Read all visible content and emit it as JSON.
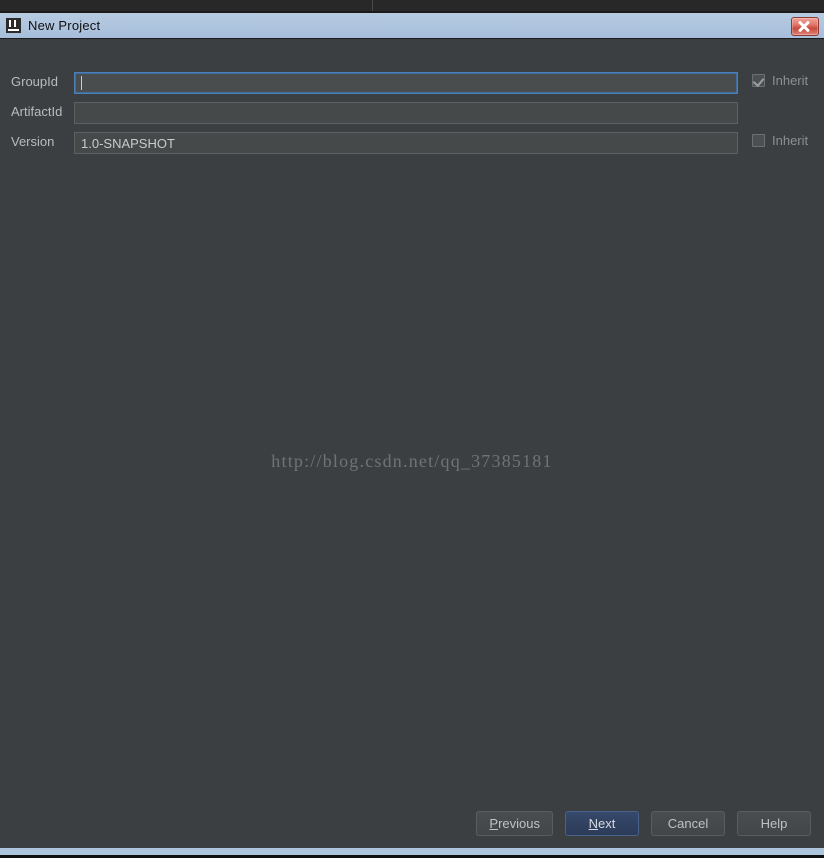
{
  "window": {
    "title": "New Project",
    "app_icon": "intellij-idea-logo-icon",
    "close_icon": "close-icon",
    "titlebar_color": "#b0c6de",
    "body_color": "#3c3f41",
    "frame_accent_color": "#aec5de"
  },
  "form": {
    "rows": [
      {
        "label": "GroupId",
        "value": "",
        "placeholder": "",
        "focused": true,
        "has_inherit": true,
        "inherit_label": "Inherit",
        "inherit_checked": true
      },
      {
        "label": "ArtifactId",
        "value": "",
        "placeholder": "",
        "focused": false,
        "has_inherit": false,
        "inherit_label": "",
        "inherit_checked": false
      },
      {
        "label": "Version",
        "value": "1.0-SNAPSHOT",
        "placeholder": "",
        "focused": false,
        "has_inherit": true,
        "inherit_label": "Inherit",
        "inherit_checked": false
      }
    ]
  },
  "watermark": {
    "text": "http://blog.csdn.net/qq_37385181",
    "color": "#6f7375"
  },
  "buttons": [
    {
      "label": "Previous",
      "mnemonic": "P",
      "default": false
    },
    {
      "label": "Next",
      "mnemonic": "N",
      "default": true
    },
    {
      "label": "Cancel",
      "mnemonic": "",
      "default": false
    },
    {
      "label": "Help",
      "mnemonic": "",
      "default": false
    }
  ],
  "button_labels": {
    "previous_pre": "",
    "previous_mn": "P",
    "previous_post": "revious",
    "next_pre": "",
    "next_mn": "N",
    "next_post": "ext",
    "cancel": "Cancel",
    "help": "Help"
  }
}
